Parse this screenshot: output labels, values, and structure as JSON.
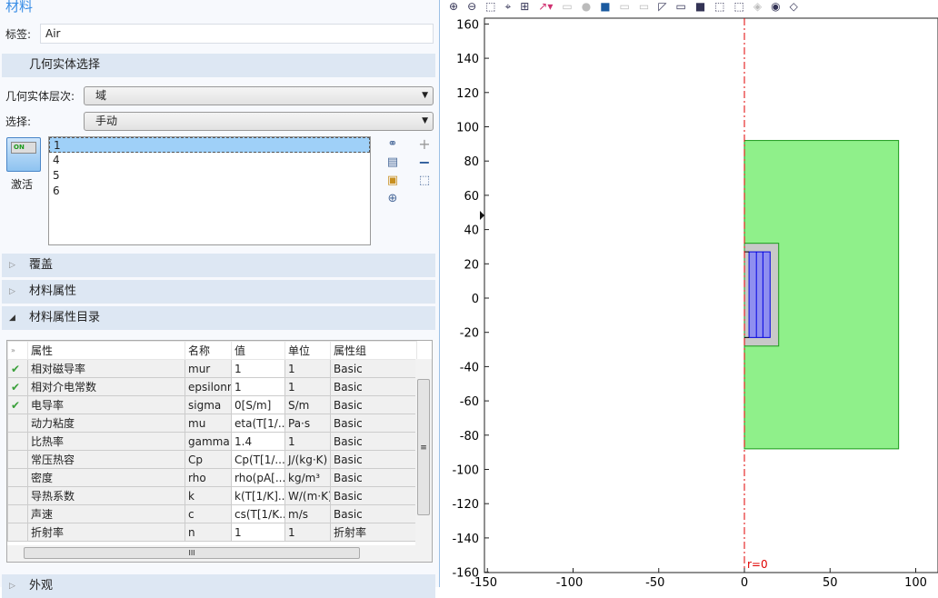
{
  "panel": {
    "title": "材料",
    "label_caption": "标签:",
    "label_value": "Air",
    "geom_section": "几何实体选择",
    "level_caption": "几何实体层次:",
    "level_value": "域",
    "selection_caption": "选择:",
    "selection_value": "手动",
    "active_toggle": "ON",
    "active_label": "激活",
    "domains": [
      "1",
      "4",
      "5",
      "6"
    ],
    "sections": {
      "override": "覆盖",
      "props": "材料属性",
      "catalog": "材料属性目录",
      "appearance": "外观"
    },
    "table": {
      "headers": [
        "属性",
        "名称",
        "值",
        "单位",
        "属性组"
      ],
      "rows": [
        {
          "check": true,
          "prop": "相对磁导率",
          "name": "mur",
          "value": "1",
          "unit": "1",
          "group": "Basic"
        },
        {
          "check": true,
          "prop": "相对介电常数",
          "name": "epsilonr",
          "value": "1",
          "unit": "1",
          "group": "Basic"
        },
        {
          "check": true,
          "prop": "电导率",
          "name": "sigma",
          "value": "0[S/m]",
          "unit": "S/m",
          "group": "Basic"
        },
        {
          "check": false,
          "prop": "动力粘度",
          "name": "mu",
          "value": "eta(T[1/...",
          "unit": "Pa·s",
          "group": "Basic"
        },
        {
          "check": false,
          "prop": "比热率",
          "name": "gamma",
          "value": "1.4",
          "unit": "1",
          "group": "Basic"
        },
        {
          "check": false,
          "prop": "常压热容",
          "name": "Cp",
          "value": "Cp(T[1/...",
          "unit": "J/(kg·K)",
          "group": "Basic"
        },
        {
          "check": false,
          "prop": "密度",
          "name": "rho",
          "value": "rho(pA[...",
          "unit": "kg/m³",
          "group": "Basic"
        },
        {
          "check": false,
          "prop": "导热系数",
          "name": "k",
          "value": "k(T[1/K]...",
          "unit": "W/(m·K)",
          "group": "Basic"
        },
        {
          "check": false,
          "prop": "声速",
          "name": "c",
          "value": "cs(T[1/K...",
          "unit": "m/s",
          "group": "Basic"
        },
        {
          "check": false,
          "prop": "折射率",
          "name": "n",
          "value": "1",
          "unit": "1",
          "group": "折射率"
        }
      ]
    }
  },
  "plot": {
    "xticks": [
      -150,
      -100,
      -50,
      0,
      50,
      100
    ],
    "yticks": [
      160,
      140,
      120,
      100,
      80,
      60,
      40,
      20,
      0,
      -20,
      -40,
      -60,
      -80,
      -100,
      -120,
      -140,
      -160
    ],
    "axis_label": "r=0",
    "colors": {
      "air": "#8ff08a",
      "gray": "#c8c8c8",
      "coil": "#8f8ff0",
      "axis": "#e00000"
    }
  }
}
